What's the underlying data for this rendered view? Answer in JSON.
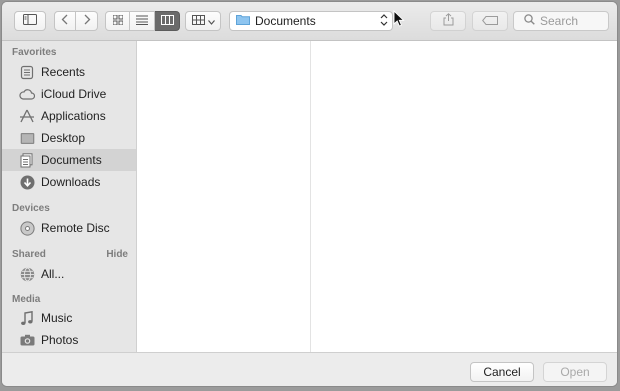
{
  "toolbar": {
    "path_popup_label": "Documents",
    "search_placeholder": "Search",
    "view_modes": [
      "icon",
      "list",
      "column"
    ],
    "active_view": "column"
  },
  "sidebar": {
    "favorites_header": "Favorites",
    "favorites": [
      {
        "label": "Recents",
        "icon": "recents-icon"
      },
      {
        "label": "iCloud Drive",
        "icon": "cloud-icon"
      },
      {
        "label": "Applications",
        "icon": "applications-icon"
      },
      {
        "label": "Desktop",
        "icon": "desktop-icon"
      },
      {
        "label": "Documents",
        "icon": "document-icon",
        "selected": true
      },
      {
        "label": "Downloads",
        "icon": "download-icon"
      }
    ],
    "devices_header": "Devices",
    "devices": [
      {
        "label": "Remote Disc",
        "icon": "disc-icon"
      }
    ],
    "shared_header": "Shared",
    "shared_hide": "Hide",
    "shared": [
      {
        "label": "All...",
        "icon": "network-icon"
      }
    ],
    "media_header": "Media",
    "media": [
      {
        "label": "Music",
        "icon": "music-icon"
      },
      {
        "label": "Photos",
        "icon": "camera-icon"
      }
    ]
  },
  "footer": {
    "cancel_label": "Cancel",
    "open_label": "Open"
  },
  "colors": {
    "selected_row": "#d3d3d3",
    "active_segment": "#6b6b6b",
    "folder_blue": "#6fb3e6"
  }
}
